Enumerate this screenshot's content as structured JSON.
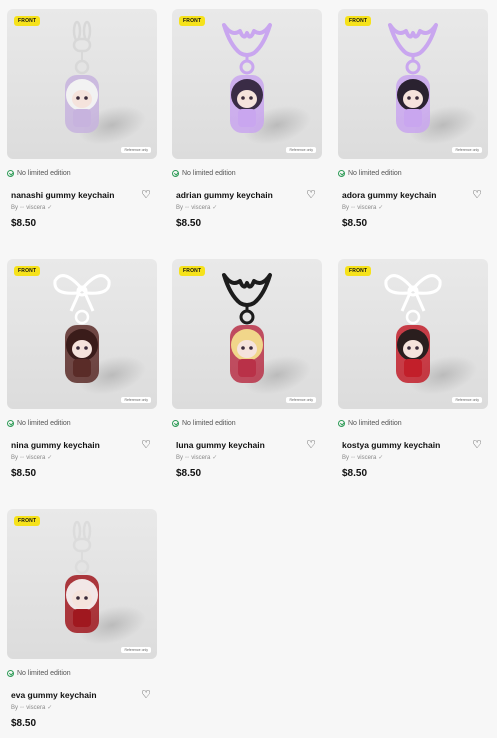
{
  "badge_label": "FRONT",
  "reference_label": "Reference only",
  "limited_label": "No limited edition",
  "by_label": "By",
  "creator_name": "viscera",
  "heart_glyph": "♡",
  "products": [
    {
      "title": "nanashi gummy keychain",
      "price": "$8.50",
      "clasp": "bunny-clip",
      "clasp_color": "#d8d8d8",
      "figure_color": "#c7b3de",
      "hair_color": "#f2f2f2"
    },
    {
      "title": "adrian gummy keychain",
      "price": "$8.50",
      "clasp": "bat",
      "clasp_color": "#c9a6ef",
      "figure_color": "#c9a6ef",
      "hair_color": "#3a2c46"
    },
    {
      "title": "adora gummy keychain",
      "price": "$8.50",
      "clasp": "bat",
      "clasp_color": "#c9a6ef",
      "figure_color": "#c9a6ef",
      "hair_color": "#2a2230"
    },
    {
      "title": "nina gummy keychain",
      "price": "$8.50",
      "clasp": "bow",
      "clasp_color": "#ffffff",
      "figure_color": "#5a2c28",
      "hair_color": "#3a1c1a"
    },
    {
      "title": "luna gummy keychain",
      "price": "$8.50",
      "clasp": "bat",
      "clasp_color": "#1c1c1c",
      "figure_color": "#b93148",
      "hair_color": "#f1d68a"
    },
    {
      "title": "kostya gummy keychain",
      "price": "$8.50",
      "clasp": "bow",
      "clasp_color": "#ffffff",
      "figure_color": "#c21f2a",
      "hair_color": "#2a1e1e"
    },
    {
      "title": "eva gummy keychain",
      "price": "$8.50",
      "clasp": "bunny-clip",
      "clasp_color": "#dcdcdc",
      "figure_color": "#a0181f",
      "hair_color": "#f2e7e7"
    }
  ]
}
